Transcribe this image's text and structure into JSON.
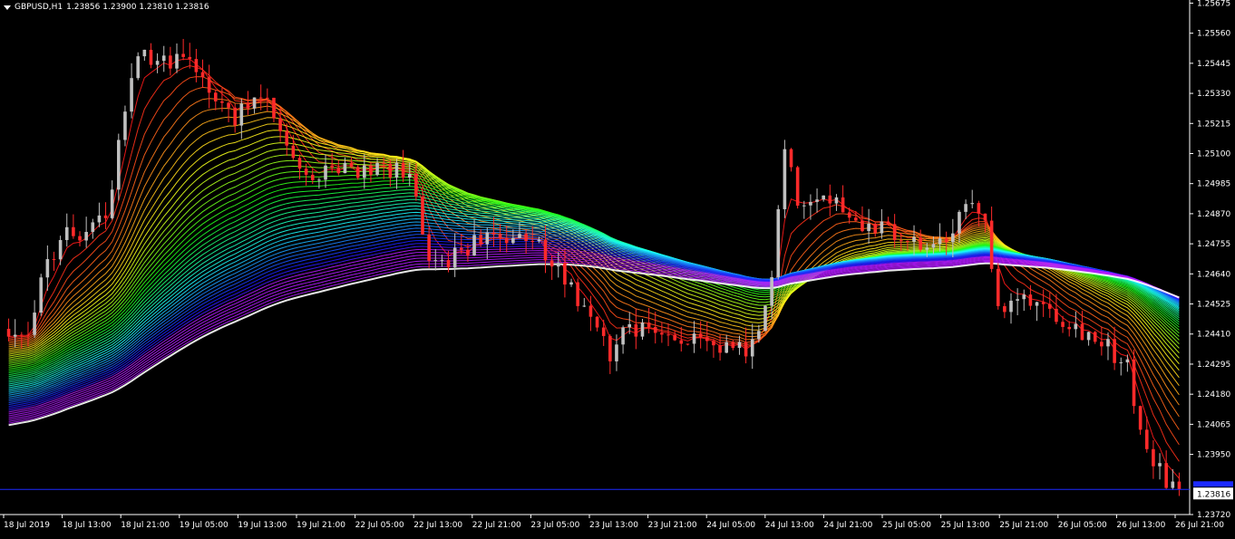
{
  "header": {
    "symbol": "GBPUSD,H1",
    "ohlc": "1.23856 1.23900 1.23810 1.23816"
  },
  "colors": {
    "background": "#000000",
    "axis": "#ffffff",
    "bull": "#c0c0c0",
    "bear": "#ff2a2a",
    "price_line": "#1c2aff",
    "price_label_bg": "#ffffff"
  },
  "chart_data": {
    "type": "candlestick",
    "symbol": "GBPUSD",
    "timeframe": "H1",
    "ylim": [
      1.2372,
      1.2568
    ],
    "y_ticks": [
      "1.25675",
      "1.25560",
      "1.25445",
      "1.25330",
      "1.25215",
      "1.25100",
      "1.24985",
      "1.24870",
      "1.24755",
      "1.24640",
      "1.24525",
      "1.24410",
      "1.24295",
      "1.24180",
      "1.24065",
      "1.23950",
      "1.23720"
    ],
    "x_ticks": [
      "18 Jul 2019",
      "18 Jul 13:00",
      "18 Jul 21:00",
      "19 Jul 05:00",
      "19 Jul 13:00",
      "19 Jul 21:00",
      "22 Jul 05:00",
      "22 Jul 13:00",
      "22 Jul 21:00",
      "23 Jul 05:00",
      "23 Jul 13:00",
      "23 Jul 21:00",
      "24 Jul 05:00",
      "24 Jul 13:00",
      "24 Jul 21:00",
      "25 Jul 05:00",
      "25 Jul 13:00",
      "25 Jul 21:00",
      "26 Jul 05:00",
      "26 Jul 13:00",
      "26 Jul 21:00"
    ],
    "current_price": "1.23816",
    "close_anchors": [
      [
        0,
        1.244
      ],
      [
        3,
        1.2439
      ],
      [
        5,
        1.2462
      ],
      [
        8,
        1.2478
      ],
      [
        12,
        1.248
      ],
      [
        15,
        1.2485
      ],
      [
        18,
        1.2528
      ],
      [
        20,
        1.2551
      ],
      [
        23,
        1.2543
      ],
      [
        26,
        1.2548
      ],
      [
        29,
        1.2545
      ],
      [
        32,
        1.253
      ],
      [
        35,
        1.2524
      ],
      [
        38,
        1.2532
      ],
      [
        41,
        1.2525
      ],
      [
        44,
        1.2505
      ],
      [
        47,
        1.2501
      ],
      [
        50,
        1.2502
      ],
      [
        53,
        1.2504
      ],
      [
        56,
        1.2503
      ],
      [
        59,
        1.2503
      ],
      [
        62,
        1.2502
      ],
      [
        65,
        1.2472
      ],
      [
        68,
        1.2467
      ],
      [
        70,
        1.2474
      ],
      [
        73,
        1.2476
      ],
      [
        76,
        1.2478
      ],
      [
        79,
        1.2476
      ],
      [
        82,
        1.2474
      ],
      [
        85,
        1.2466
      ],
      [
        88,
        1.2455
      ],
      [
        91,
        1.2446
      ],
      [
        93,
        1.243
      ],
      [
        95,
        1.2445
      ],
      [
        98,
        1.2443
      ],
      [
        101,
        1.2441
      ],
      [
        104,
        1.244
      ],
      [
        107,
        1.2436
      ],
      [
        110,
        1.2435
      ],
      [
        113,
        1.2434
      ],
      [
        116,
        1.244
      ],
      [
        118,
        1.246
      ],
      [
        120,
        1.2515
      ],
      [
        122,
        1.2492
      ],
      [
        125,
        1.2496
      ],
      [
        128,
        1.2492
      ],
      [
        131,
        1.2485
      ],
      [
        134,
        1.2482
      ],
      [
        137,
        1.2478
      ],
      [
        140,
        1.2475
      ],
      [
        143,
        1.2473
      ],
      [
        146,
        1.2479
      ],
      [
        149,
        1.2494
      ],
      [
        151,
        1.2487
      ],
      [
        153,
        1.2448
      ],
      [
        155,
        1.2452
      ],
      [
        158,
        1.2455
      ],
      [
        161,
        1.2451
      ],
      [
        164,
        1.2446
      ],
      [
        167,
        1.2441
      ],
      [
        170,
        1.2436
      ],
      [
        173,
        1.2428
      ],
      [
        175,
        1.2404
      ],
      [
        177,
        1.2393
      ],
      [
        179,
        1.2385
      ],
      [
        181,
        1.23816
      ]
    ]
  }
}
